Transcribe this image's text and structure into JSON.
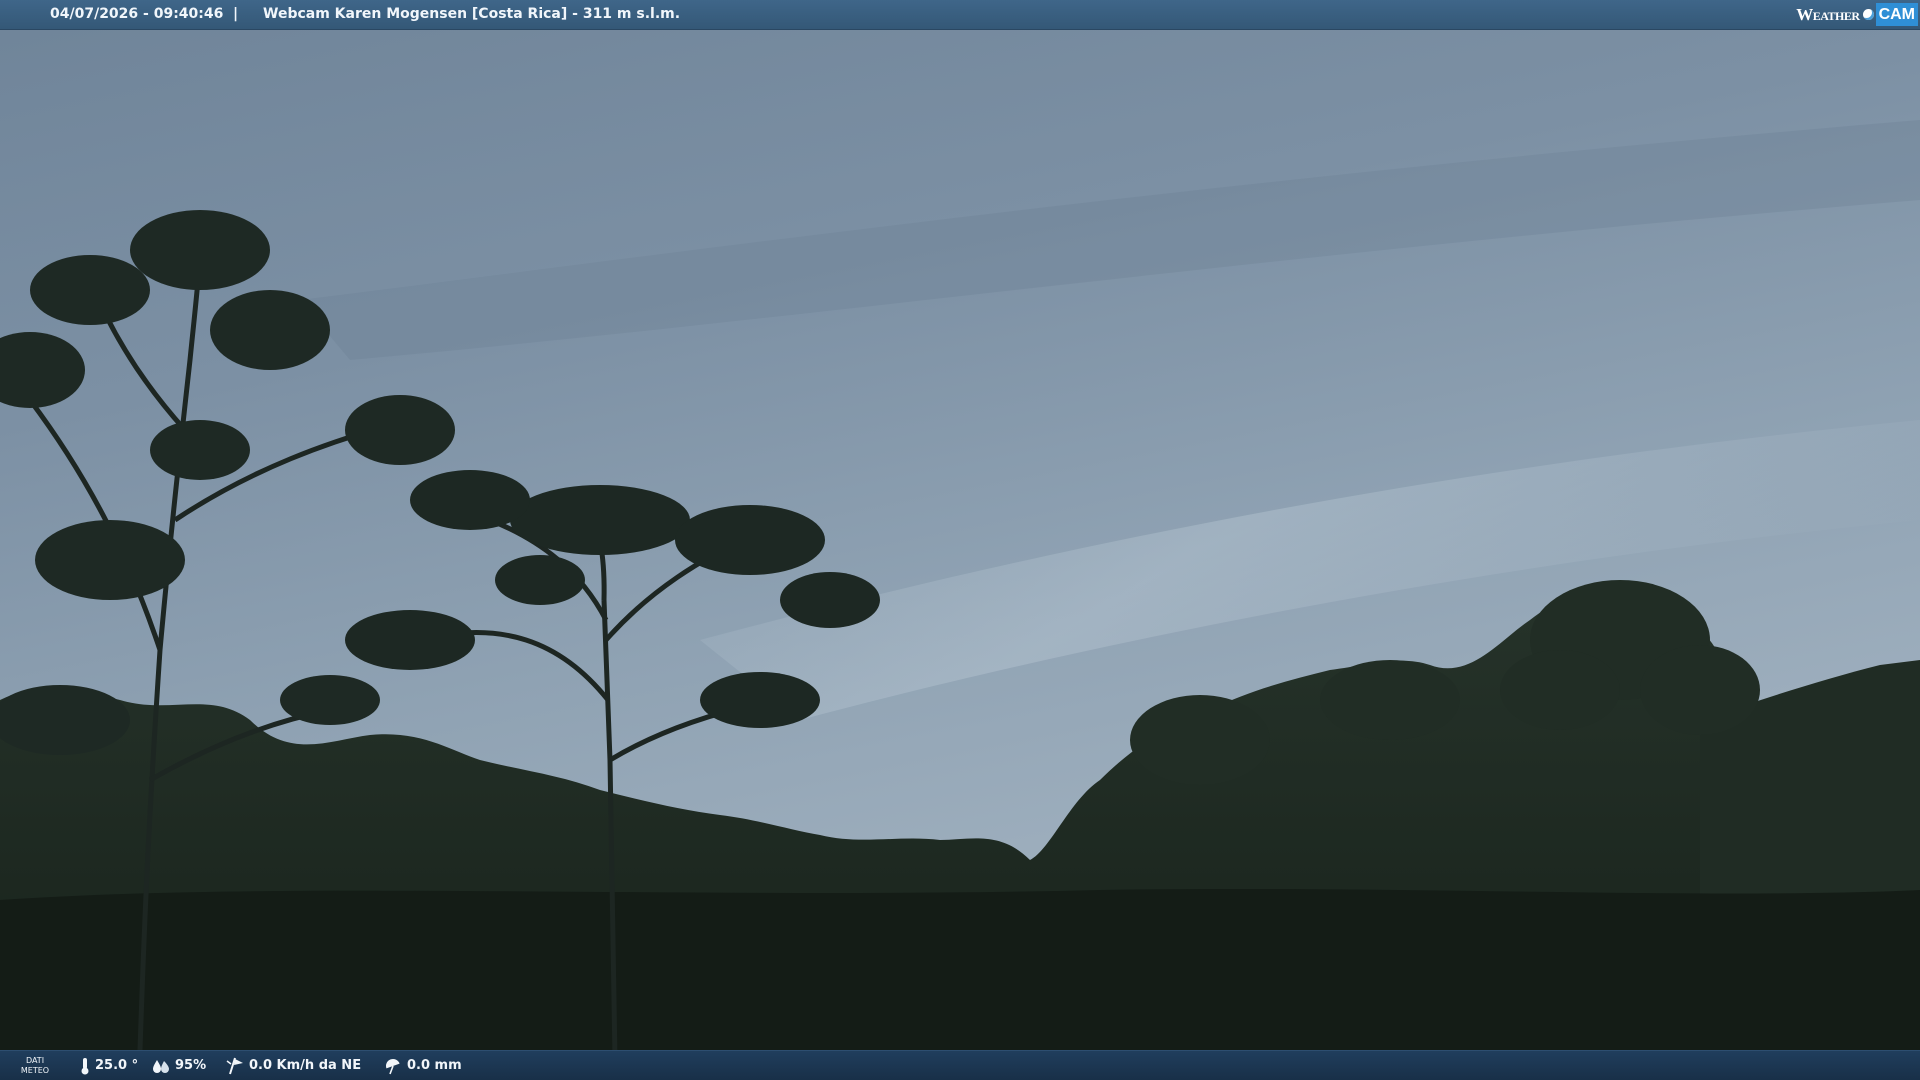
{
  "header": {
    "datetime": "04/07/2026 - 09:40:46",
    "separator": "|",
    "title": "Webcam Karen Mogensen [Costa Rica]  - 311 m s.l.m."
  },
  "logo": {
    "word_weather": "Weather",
    "word_cam": "CAM"
  },
  "footer": {
    "meteo_label_line1": "DATI",
    "meteo_label_line2": "METEO",
    "temperature": "25.0 °",
    "humidity": "95%",
    "wind": "0.0 Km/h da NE",
    "rain": "0.0 mm",
    "icons": {
      "temperature": "thermometer-icon",
      "humidity": "humidity-drop-icon",
      "wind": "wind-flag-icon",
      "rain": "rain-umbrella-icon"
    }
  },
  "colors": {
    "header_bar": "#3d6385",
    "footer_bar": "#1d3854",
    "sky": "#7f93a6",
    "vegetation": "#1f2b23"
  }
}
